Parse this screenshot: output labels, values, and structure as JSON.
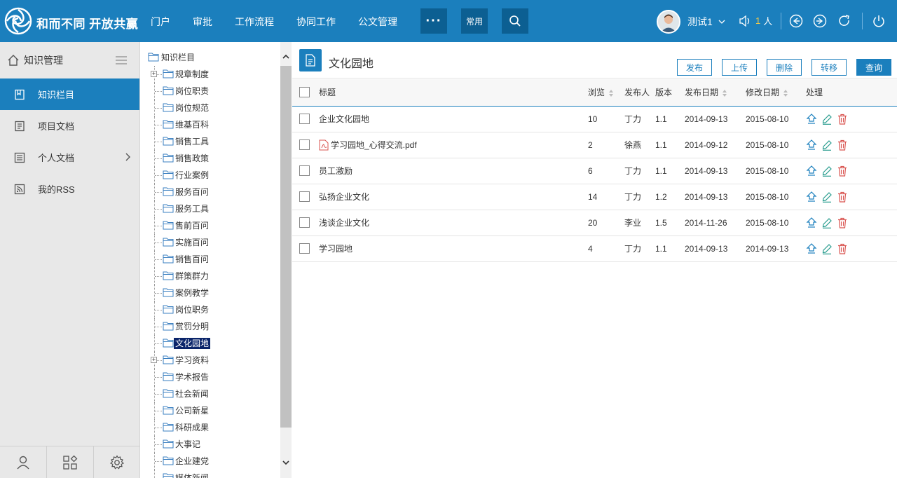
{
  "brand": {
    "name": "和而不同 开放共赢"
  },
  "topnav": {
    "items": [
      {
        "label": "门户"
      },
      {
        "label": "审批"
      },
      {
        "label": "工作流程"
      },
      {
        "label": "协同工作"
      },
      {
        "label": "公文管理"
      }
    ],
    "more_label": "···",
    "common_label": "常用"
  },
  "user": {
    "name": "测试1",
    "online_count": "1",
    "online_unit": "人"
  },
  "leftnav": {
    "title": "知识管理",
    "items": [
      {
        "label": "知识栏目",
        "icon": "book-icon",
        "active": true
      },
      {
        "label": "项目文档",
        "icon": "document-icon"
      },
      {
        "label": "个人文档",
        "icon": "list-icon",
        "has_children": true
      },
      {
        "label": "我的RSS",
        "icon": "rss-icon"
      }
    ]
  },
  "tree": {
    "root": "知识栏目",
    "nodes": [
      {
        "label": "规章制度",
        "expandable": true
      },
      {
        "label": "岗位职责"
      },
      {
        "label": "岗位规范"
      },
      {
        "label": "维基百科"
      },
      {
        "label": "销售工具"
      },
      {
        "label": "销售政策"
      },
      {
        "label": "行业案例"
      },
      {
        "label": "服务百问"
      },
      {
        "label": "服务工具"
      },
      {
        "label": "售前百问"
      },
      {
        "label": "实施百问"
      },
      {
        "label": "销售百问"
      },
      {
        "label": "群策群力"
      },
      {
        "label": "案例教学"
      },
      {
        "label": "岗位职务"
      },
      {
        "label": "赏罚分明"
      },
      {
        "label": "文化园地",
        "selected": true
      },
      {
        "label": "学习资料",
        "expandable": true
      },
      {
        "label": "学术报告"
      },
      {
        "label": "社会新闻"
      },
      {
        "label": "公司新星"
      },
      {
        "label": "科研成果"
      },
      {
        "label": "大事记"
      },
      {
        "label": "企业建党"
      },
      {
        "label": "媒体新闻"
      }
    ]
  },
  "main": {
    "title": "文化园地",
    "actions": [
      {
        "label": "发布"
      },
      {
        "label": "上传"
      },
      {
        "label": "删除"
      },
      {
        "label": "转移"
      },
      {
        "label": "查询",
        "primary": true
      }
    ],
    "columns": {
      "title": "标题",
      "views": "浏览",
      "publisher": "发布人",
      "version": "版本",
      "publish_date": "发布日期",
      "modify_date": "修改日期",
      "ops": "处理"
    },
    "rows": [
      {
        "title": "企业文化园地",
        "views": "10",
        "publisher": "丁力",
        "version": "1.1",
        "publish_date": "2014-09-13",
        "modify_date": "2015-08-10"
      },
      {
        "title": "学习园地_心得交流.pdf",
        "pdf": true,
        "views": "2",
        "publisher": "徐燕",
        "version": "1.1",
        "publish_date": "2014-09-12",
        "modify_date": "2015-08-10"
      },
      {
        "title": "员工激励",
        "views": "6",
        "publisher": "丁力",
        "version": "1.1",
        "publish_date": "2014-09-13",
        "modify_date": "2015-08-10"
      },
      {
        "title": "弘扬企业文化",
        "views": "14",
        "publisher": "丁力",
        "version": "1.2",
        "publish_date": "2014-09-13",
        "modify_date": "2015-08-10"
      },
      {
        "title": "浅谈企业文化",
        "views": "20",
        "publisher": "李业",
        "version": "1.5",
        "publish_date": "2014-11-26",
        "modify_date": "2015-08-10"
      },
      {
        "title": "学习园地",
        "views": "4",
        "publisher": "丁力",
        "version": "1.1",
        "publish_date": "2014-09-13",
        "modify_date": "2014-09-13"
      }
    ]
  },
  "colors": {
    "primary": "#1b7fbd",
    "dark": "#0c5f92",
    "delete": "#d9534f",
    "edit": "#2a9d8f"
  }
}
